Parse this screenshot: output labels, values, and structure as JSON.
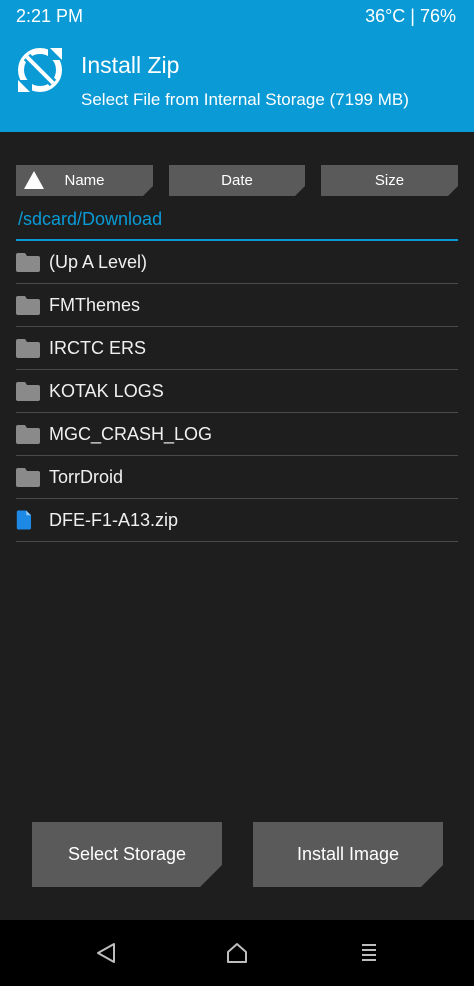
{
  "status_bar": {
    "time": "2:21 PM",
    "temp_battery": "36°C | 76%"
  },
  "header": {
    "title": "Install Zip",
    "subtitle": "Select File from Internal Storage (7199 MB)",
    "logo_icon": "twrp-logo-icon"
  },
  "sort": {
    "name_label": "Name",
    "date_label": "Date",
    "size_label": "Size",
    "active_sort": "Name",
    "sort_icon": "triangle-up-icon"
  },
  "path": "/sdcard/Download",
  "files": [
    {
      "label": "(Up A Level)",
      "icon": "folder-icon"
    },
    {
      "label": "FMThemes",
      "icon": "folder-icon"
    },
    {
      "label": "IRCTC ERS",
      "icon": "folder-icon"
    },
    {
      "label": "KOTAK LOGS",
      "icon": "folder-icon"
    },
    {
      "label": "MGC_CRASH_LOG",
      "icon": "folder-icon"
    },
    {
      "label": "TorrDroid",
      "icon": "folder-icon"
    },
    {
      "label": "DFE-F1-A13.zip",
      "icon": "file-icon"
    }
  ],
  "actions": {
    "select_storage": "Select Storage",
    "install_image": "Install Image"
  },
  "nav": {
    "back_icon": "back-icon",
    "home_icon": "home-icon",
    "menu_icon": "menu-icon"
  },
  "colors": {
    "accent": "#0a9bd6",
    "background": "#1e1e1e",
    "button": "#5a5a5a",
    "folder": "#8a8a8a",
    "file": "#1e88e5"
  }
}
